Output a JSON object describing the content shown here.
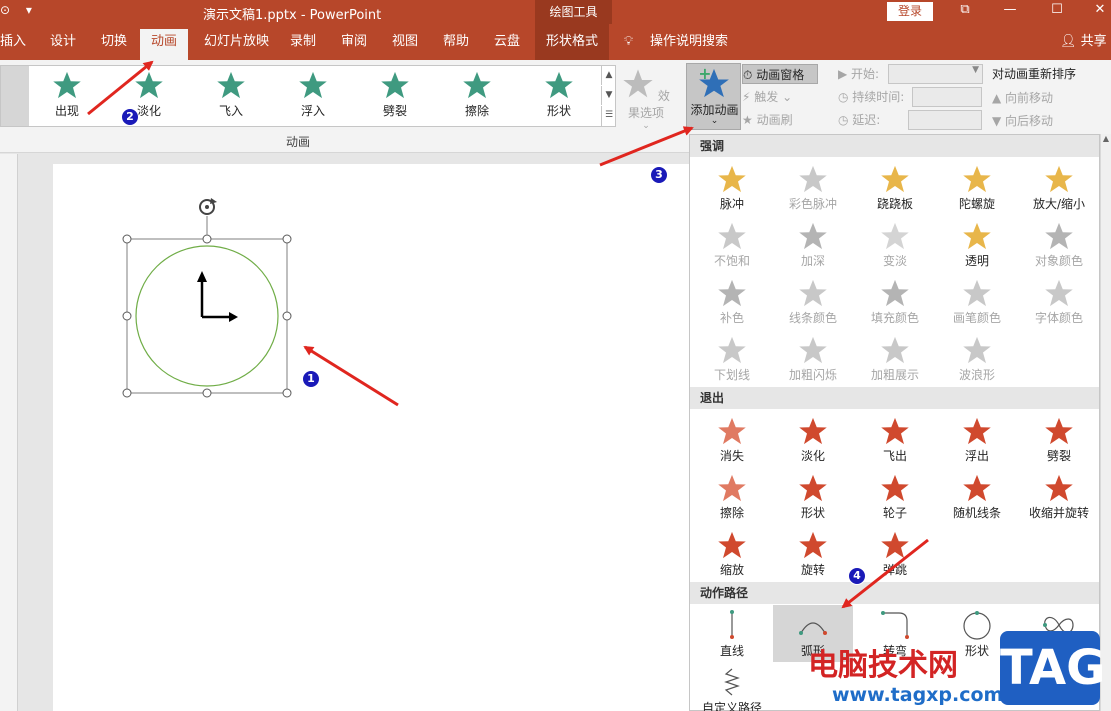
{
  "titlebar": {
    "doc_title": "演示文稿1.pptx  -  PowerPoint",
    "context_tool": "绘图工具",
    "login": "登录",
    "controls": [
      "⧉",
      "—",
      "☐",
      "✕"
    ]
  },
  "tabs": {
    "items": [
      "插入",
      "设计",
      "切换",
      "动画",
      "幻灯片放映",
      "录制",
      "审阅",
      "视图",
      "帮助",
      "云盘",
      "形状格式"
    ],
    "active": "动画",
    "tell_me": "操作说明搜索",
    "share": "共享"
  },
  "ribbon": {
    "gallery": [
      "出现",
      "淡化",
      "飞入",
      "浮入",
      "劈裂",
      "擦除",
      "形状"
    ],
    "group_label": "动画",
    "effect_options": "效果选项",
    "add_animation": "添加动画",
    "animation_pane": "动画窗格",
    "trigger": "触发",
    "painter": "动画刷",
    "start": "开始:",
    "duration": "持续时间:",
    "delay": "延迟:",
    "reorder_title": "对动画重新排序",
    "move_earlier": "向前移动",
    "move_later": "向后移动"
  },
  "dropdown": {
    "emphasis_title": "强调",
    "emphasis": [
      {
        "label": "脉冲",
        "enabled": true,
        "color": "#e8b64a"
      },
      {
        "label": "彩色脉冲",
        "enabled": false,
        "color": "#c8c8c8"
      },
      {
        "label": "跷跷板",
        "enabled": true,
        "color": "#e8b64a"
      },
      {
        "label": "陀螺旋",
        "enabled": true,
        "color": "#e8b64a"
      },
      {
        "label": "放大/缩小",
        "enabled": true,
        "color": "#e8b64a"
      },
      {
        "label": "不饱和",
        "enabled": false,
        "color": "#c8c8c8"
      },
      {
        "label": "加深",
        "enabled": false,
        "color": "#b4b4b4"
      },
      {
        "label": "变淡",
        "enabled": false,
        "color": "#d4d4d4"
      },
      {
        "label": "透明",
        "enabled": true,
        "color": "#e8b64a"
      },
      {
        "label": "对象颜色",
        "enabled": false,
        "color": "#b4b4b4"
      },
      {
        "label": "补色",
        "enabled": false,
        "color": "#b4b4b4"
      },
      {
        "label": "线条颜色",
        "enabled": false,
        "color": "#c8c8c8"
      },
      {
        "label": "填充颜色",
        "enabled": false,
        "color": "#b4b4b4"
      },
      {
        "label": "画笔颜色",
        "enabled": false,
        "color": "#c8c8c8"
      },
      {
        "label": "字体颜色",
        "enabled": false,
        "color": "#c8c8c8"
      },
      {
        "label": "下划线",
        "enabled": false,
        "color": "#c8c8c8"
      },
      {
        "label": "加粗闪烁",
        "enabled": false,
        "color": "#c8c8c8"
      },
      {
        "label": "加粗展示",
        "enabled": false,
        "color": "#c8c8c8"
      },
      {
        "label": "波浪形",
        "enabled": false,
        "color": "#c8c8c8"
      }
    ],
    "exit_title": "退出",
    "exit": [
      {
        "label": "消失",
        "color": "#e07a62"
      },
      {
        "label": "淡化",
        "color": "#d0492e"
      },
      {
        "label": "飞出",
        "color": "#d0492e"
      },
      {
        "label": "浮出",
        "color": "#d0492e"
      },
      {
        "label": "劈裂",
        "color": "#d0492e"
      },
      {
        "label": "擦除",
        "color": "#e07a62"
      },
      {
        "label": "形状",
        "color": "#d0492e"
      },
      {
        "label": "轮子",
        "color": "#d0492e"
      },
      {
        "label": "随机线条",
        "color": "#d0492e"
      },
      {
        "label": "收缩并旋转",
        "color": "#d0492e"
      },
      {
        "label": "缩放",
        "color": "#d0492e"
      },
      {
        "label": "旋转",
        "color": "#d0492e"
      },
      {
        "label": "弹跳",
        "color": "#d0492e"
      }
    ],
    "path_title": "动作路径",
    "paths": [
      "直线",
      "弧形",
      "转弯",
      "形状",
      "循环",
      "自定义路径"
    ],
    "hovered_path": "弧形"
  },
  "annotations": {
    "badges": [
      "1",
      "2",
      "3",
      "4"
    ]
  },
  "watermark": {
    "site_cn": "电脑技术网",
    "site_url": "www.tagxp.com",
    "logo": "TAG"
  },
  "colors": {
    "accent": "#b7472a",
    "accent_dark": "#99391f",
    "entrance_star": "#3f9a80",
    "arrow": "#e0261f",
    "badge": "#1a1ab8"
  }
}
